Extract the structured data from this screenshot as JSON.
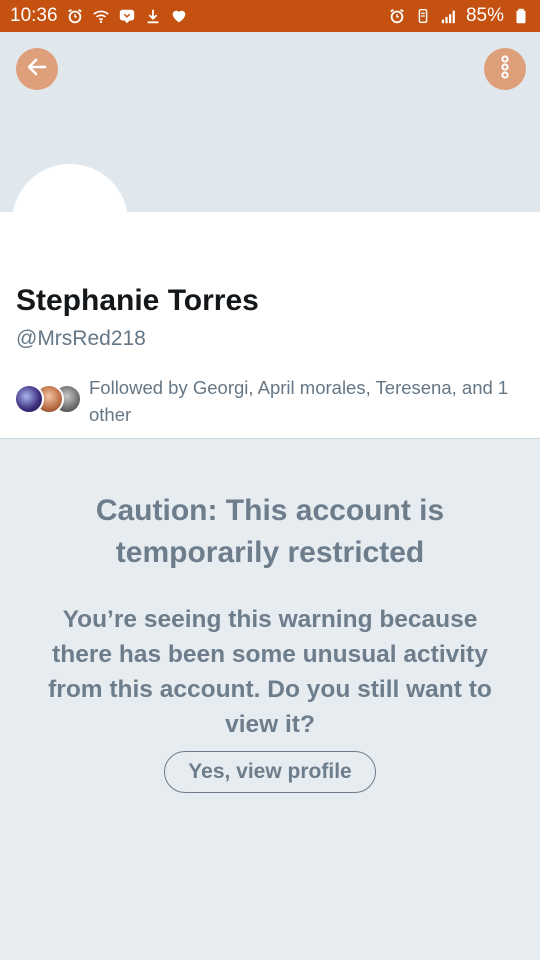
{
  "status_bar": {
    "time": "10:36",
    "battery": "85%",
    "left_icons": [
      "alarm-icon",
      "wifi-icon",
      "chat-icon",
      "download-icon",
      "heart-icon"
    ],
    "right_icons": [
      "alarm-icon",
      "network-icon",
      "signal-icon",
      "battery-icon"
    ],
    "bg_color": "#c4510f"
  },
  "header": {
    "back_icon": "arrow-left-icon",
    "more_icon": "more-vertical-icon",
    "button_color": "#de9f7b"
  },
  "profile": {
    "name": "Stephanie Torres",
    "handle": "@MrsRed218",
    "followed_by": "Followed by Georgi, April morales, Teresena, and 1 other"
  },
  "caution": {
    "title": "Caution: This account is temporarily restricted",
    "message": "You’re seeing this warning because there has been some unusual activity from this account. Do you still want to view it?",
    "button_label": "Yes, view profile"
  }
}
